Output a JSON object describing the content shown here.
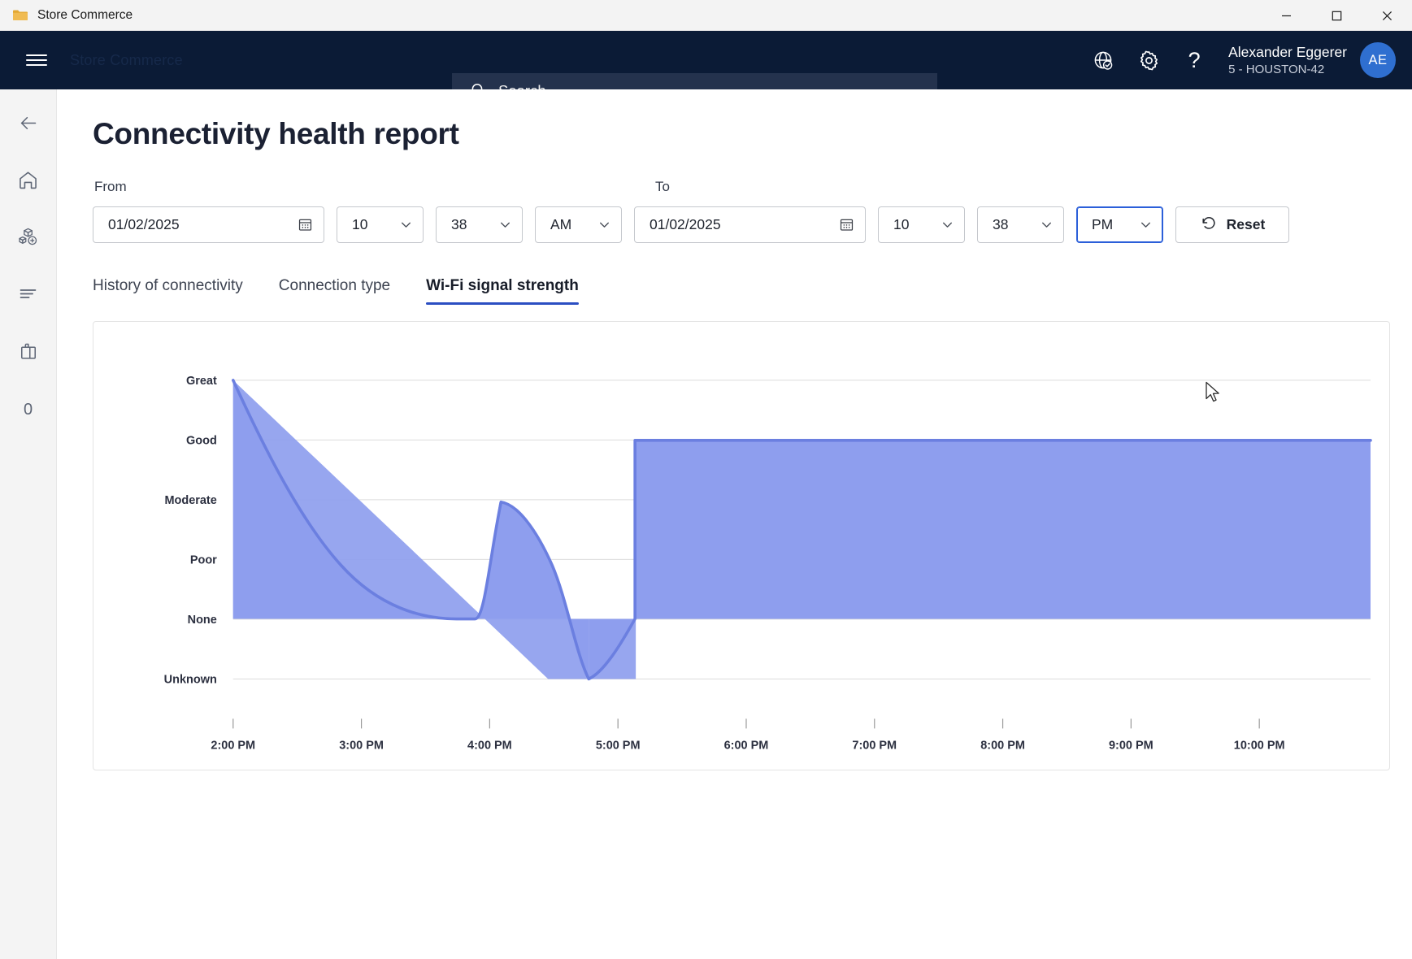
{
  "window": {
    "title": "Store Commerce",
    "app_icon": "folder-icon",
    "controls": [
      {
        "name": "minimize",
        "glyph": "—"
      },
      {
        "name": "maximize",
        "glyph": "□"
      },
      {
        "name": "close",
        "glyph": "✕"
      }
    ]
  },
  "header": {
    "menu_icon": "hamburger-icon",
    "ghost_text": "Store Commerce",
    "search": {
      "placeholder": "Search",
      "icon": "search-icon"
    },
    "icons": [
      {
        "name": "globe-check-icon",
        "label": "Language"
      },
      {
        "name": "gear-icon",
        "label": "Settings"
      },
      {
        "name": "question-mark-icon",
        "label": "Help"
      }
    ],
    "user": {
      "name": "Alexander Eggerer",
      "store": "5 - HOUSTON-42",
      "initials": "AE",
      "avatar_color": "#2f6fd0"
    },
    "background_color": "#0b1b36"
  },
  "sidebar": {
    "items": [
      {
        "name": "back-arrow-icon",
        "label": "Back"
      },
      {
        "name": "home-icon",
        "label": "Home"
      },
      {
        "name": "products-icon",
        "label": "Products"
      },
      {
        "name": "list-icon",
        "label": "Transactions"
      },
      {
        "name": "shopping-bag-icon",
        "label": "Cart"
      },
      {
        "name": "cart-count",
        "label": "0"
      }
    ],
    "cart_count": "0"
  },
  "page": {
    "title": "Connectivity health report"
  },
  "filters": {
    "from_label": "From",
    "to_label": "To",
    "from": {
      "date": "01/02/2025",
      "date_icon": "calendar-icon",
      "hour": "10",
      "minute": "38",
      "meridiem": "AM"
    },
    "to": {
      "date": "01/02/2025",
      "date_icon": "calendar-icon",
      "hour": "10",
      "minute": "38",
      "meridiem": "PM",
      "meridiem_focused": true
    },
    "reset": {
      "label": "Reset",
      "icon": "undo-icon"
    },
    "focus_color": "#2b5fd9"
  },
  "tabs": [
    {
      "label": "History of connectivity",
      "active": false
    },
    {
      "label": "Connection type",
      "active": false
    },
    {
      "label": "Wi-Fi signal strength",
      "active": true
    }
  ],
  "chart_data": {
    "type": "area",
    "title": "Wi-Fi signal strength",
    "xlabel": "",
    "ylabel": "",
    "grid": true,
    "legend": null,
    "line_color": "#6b7fe0",
    "fill_color": "#8e9eee",
    "baseline_category": "None",
    "y_categories": [
      "Unknown",
      "None",
      "Poor",
      "Moderate",
      "Good",
      "Great"
    ],
    "y_values": [
      0,
      1,
      2,
      3,
      4,
      5
    ],
    "x_tick_labels": [
      "2:00 PM",
      "3:00 PM",
      "4:00 PM",
      "5:00 PM",
      "6:00 PM",
      "7:00 PM",
      "8:00 PM",
      "9:00 PM",
      "10:00 PM"
    ],
    "x_range": [
      "1:50 PM",
      "10:30 PM"
    ],
    "series": [
      {
        "name": "Wi-Fi signal strength",
        "points": [
          {
            "x": "1:53 PM",
            "y": 5,
            "label": "Great"
          },
          {
            "x": "2:20 PM",
            "y": 3.6,
            "label": "Good"
          },
          {
            "x": "2:45 PM",
            "y": 2.3,
            "label": "Moderate"
          },
          {
            "x": "3:10 PM",
            "y": 1.3,
            "label": "Poor"
          },
          {
            "x": "3:32 PM",
            "y": 1.0,
            "label": "None"
          },
          {
            "x": "3:40 PM",
            "y": 1.0,
            "label": "None"
          },
          {
            "x": "3:52 PM",
            "y": 3.0,
            "label": "Moderate"
          },
          {
            "x": "4:10 PM",
            "y": 2.6,
            "label": "Moderate"
          },
          {
            "x": "4:28 PM",
            "y": 1.4,
            "label": "Poor"
          },
          {
            "x": "4:42 PM",
            "y": 0.0,
            "label": "Unknown"
          },
          {
            "x": "4:55 PM",
            "y": 1.0,
            "label": "None"
          },
          {
            "x": "4:56 PM",
            "y": 4.0,
            "label": "Good"
          },
          {
            "x": "10:30 PM",
            "y": 4.0,
            "label": "Good"
          }
        ]
      }
    ]
  }
}
